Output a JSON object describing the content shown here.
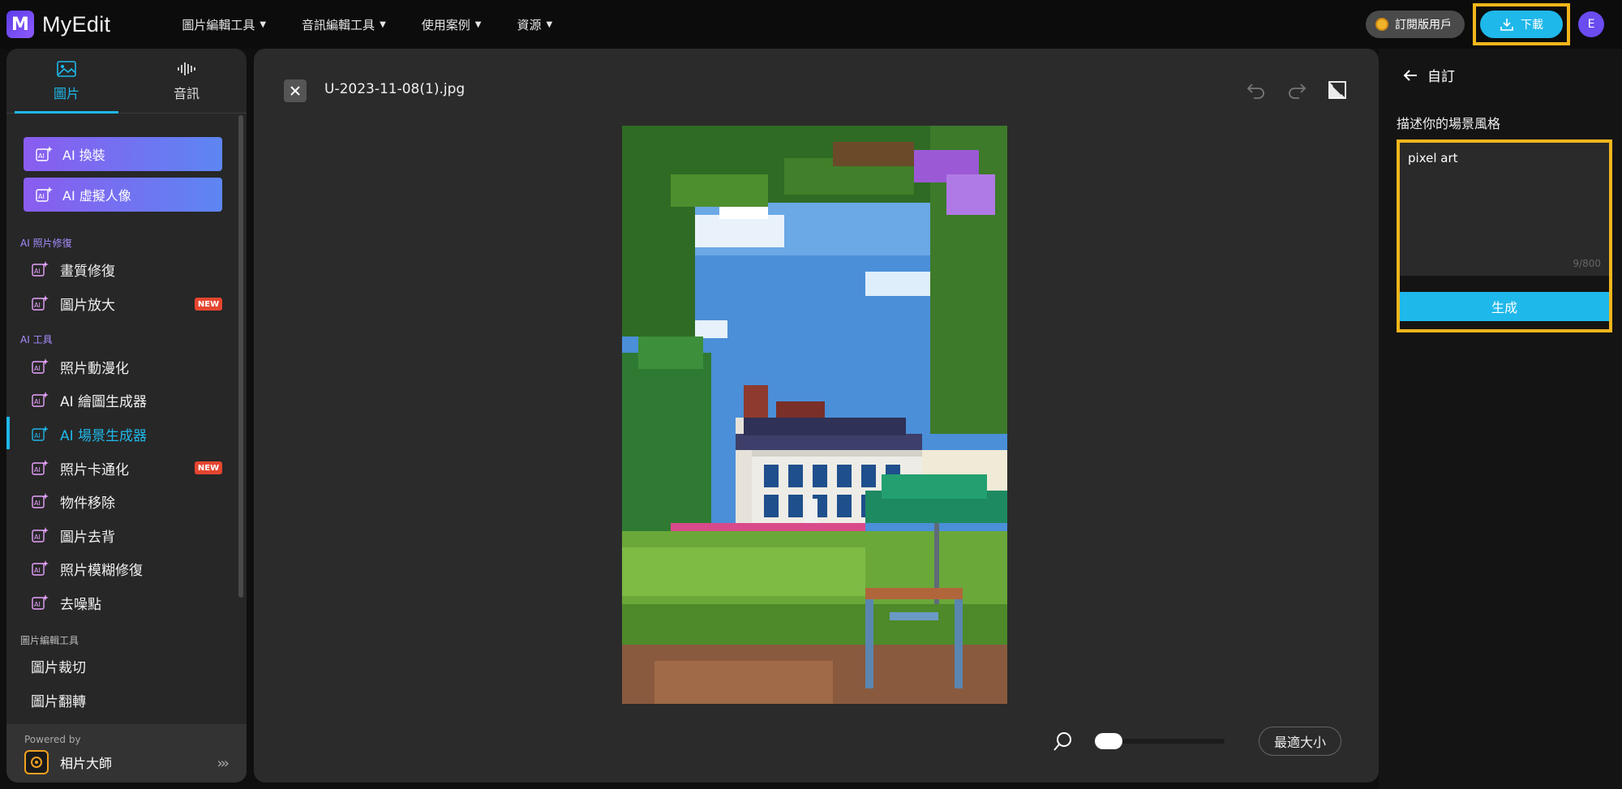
{
  "app": {
    "logo_letter": "M",
    "name": "MyEdit"
  },
  "nav": [
    {
      "label": "圖片編輯工具"
    },
    {
      "label": "音訊編輯工具"
    },
    {
      "label": "使用案例"
    },
    {
      "label": "資源"
    }
  ],
  "account": {
    "subscription_label": "訂閱版用戶",
    "download_label": "下載",
    "avatar_initial": "E"
  },
  "sidebar": {
    "tabs": [
      {
        "label": "圖片",
        "active": true
      },
      {
        "label": "音訊",
        "active": false
      }
    ],
    "cta": [
      {
        "label": "AI 換裝"
      },
      {
        "label": "AI 虛擬人像"
      }
    ],
    "sections": {
      "photo_repair": "AI 照片修復",
      "ai_tools": "AI 工具",
      "edit_tools": "圖片編輯工具"
    },
    "items": [
      {
        "label": "畫質修復"
      },
      {
        "label": "圖片放大",
        "badge": "NEW"
      },
      {
        "label": "照片動漫化"
      },
      {
        "label": "AI 繪圖生成器"
      },
      {
        "label": "AI 場景生成器",
        "active": true
      },
      {
        "label": "照片卡通化",
        "badge": "NEW"
      },
      {
        "label": "物件移除"
      },
      {
        "label": "圖片去背"
      },
      {
        "label": "照片模糊修復"
      },
      {
        "label": "去噪點"
      },
      {
        "label": "圖片裁切"
      },
      {
        "label": "圖片翻轉"
      }
    ],
    "powered_by_label": "Powered by",
    "powered_by_app": "相片大師"
  },
  "editor": {
    "filename": "U-2023-11-08(1).jpg",
    "zoom_fit_label": "最適大小",
    "zoom_level": 0
  },
  "panel": {
    "back_label": "自訂",
    "prompt_label": "描述你的場景風格",
    "prompt_value": "pixel art",
    "counter": "9/800",
    "generate_label": "生成"
  },
  "colors": {
    "accent": "#1fb8ea",
    "highlight": "#f2b61b",
    "new_badge": "#e5452f"
  }
}
